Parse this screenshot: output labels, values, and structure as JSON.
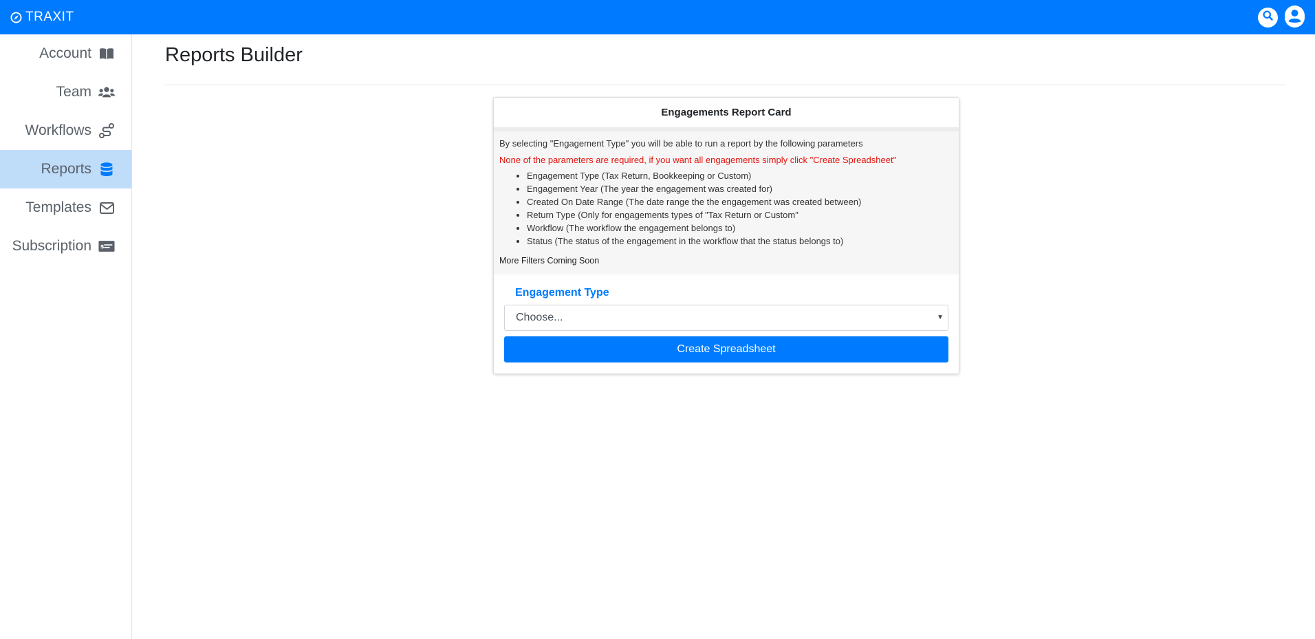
{
  "app": {
    "brand": "TRAXIT"
  },
  "topbar": {
    "search_icon": "search-icon",
    "user_icon": "user-circle-icon"
  },
  "sidebar": {
    "items": [
      {
        "label": "Account",
        "icon": "book-open-icon",
        "active": false
      },
      {
        "label": "Team",
        "icon": "users-icon",
        "active": false
      },
      {
        "label": "Workflows",
        "icon": "route-icon",
        "active": false
      },
      {
        "label": "Reports",
        "icon": "database-icon",
        "active": true
      },
      {
        "label": "Templates",
        "icon": "envelope-icon",
        "active": false
      },
      {
        "label": "Subscription",
        "icon": "money-check-icon",
        "active": false
      }
    ]
  },
  "main": {
    "title": "Reports Builder"
  },
  "card": {
    "title": "Engagements Report Card",
    "intro": "By selecting \"Engagement Type\" you will be able to run a report by the following parameters",
    "warning": "None of the parameters are required, if you want all engagements simply click \"Create Spreadsheet\"",
    "parameters": [
      "Engagement Type (Tax Return, Bookkeeping or Custom)",
      "Engagement Year (The year the engagement was created for)",
      "Created On Date Range (The date range the the engagement was created between)",
      "Return Type (Only for engagements types of \"Tax Return or Custom\"",
      "Workflow (The workflow the engagement belongs to)",
      "Status (The status of the engagement in the workflow that the status belongs to)"
    ],
    "more_filters": "More Filters Coming Soon",
    "field_label": "Engagement Type",
    "select_value": "Choose...",
    "button_label": "Create Spreadsheet"
  },
  "colors": {
    "primary": "#007bff",
    "active_nav_bg": "#bfdcf9",
    "warning_text": "#e3120b"
  }
}
